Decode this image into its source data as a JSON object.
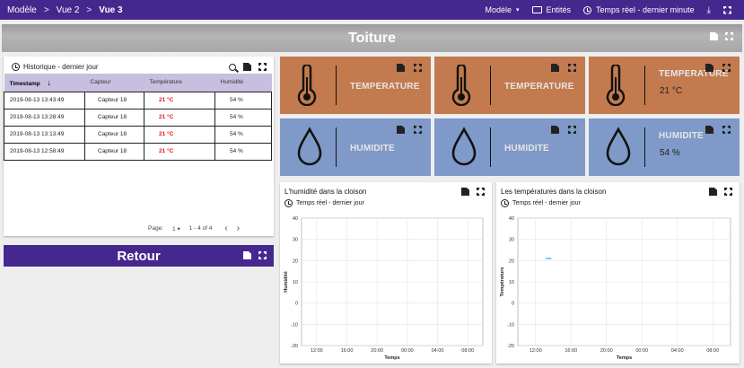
{
  "breadcrumb": {
    "items": [
      "Modèle",
      "Vue 2",
      "Vue 3"
    ],
    "separator": ">"
  },
  "topbar": {
    "model_select": "Modèle",
    "entities": "Entités",
    "realtime": "Temps réel - dernier minute"
  },
  "hero": {
    "title": "Toiture"
  },
  "history": {
    "title": "Historique - dernier jour",
    "columns": [
      "Timestamp",
      "Capteur",
      "Température",
      "Humidité"
    ],
    "rows": [
      [
        "2019-08-13 13:43:49",
        "Capteur 18",
        "21 °C",
        "54 %"
      ],
      [
        "2019-08-13 13:28:49",
        "Capteur 18",
        "21 °C",
        "54 %"
      ],
      [
        "2019-08-13 13:13:49",
        "Capteur 18",
        "21 °C",
        "54 %"
      ],
      [
        "2019-08-13 12:58:49",
        "Capteur 18",
        "21 °C",
        "54 %"
      ]
    ],
    "pager": {
      "page_label": "Page:",
      "page": "1",
      "range": "1 - 4 of 4"
    }
  },
  "retour": {
    "label": "Retour"
  },
  "tiles": {
    "temp1": {
      "label": "TEMPERATURE"
    },
    "temp2": {
      "label": "TEMPERATURE"
    },
    "temp3": {
      "label": "TEMPERATURE",
      "value": "21 °C"
    },
    "hum1": {
      "label": "HUMIDITE"
    },
    "hum2": {
      "label": "HUMIDITE"
    },
    "hum3": {
      "label": "HUMIDITE",
      "value": "54 %"
    }
  },
  "colors": {
    "header": "#45288e",
    "temp_tile": "#c27a4e",
    "hum_tile": "#7f9ac8",
    "series": "#4fc3f7",
    "alert": "#e11111"
  },
  "chart_data": [
    {
      "type": "line",
      "title": "L'humidité dans la cloison",
      "subtitle": "Temps réel - dernier jour",
      "xlabel": "Temps",
      "ylabel": "Humidité",
      "ylim": [
        -20,
        40
      ],
      "yticks": [
        -20,
        -10,
        0,
        10,
        20,
        30,
        40
      ],
      "xticks": [
        "12:00",
        "16:00",
        "20:00",
        "00:00",
        "04:00",
        "08:00"
      ],
      "grid": true,
      "series": []
    },
    {
      "type": "line",
      "title": "Les températures dans la cloison",
      "subtitle": "Temps réel - dernier jour",
      "xlabel": "Temps",
      "ylabel": "Température",
      "ylim": [
        -20,
        40
      ],
      "yticks": [
        -20,
        -10,
        0,
        10,
        20,
        30,
        40
      ],
      "xticks": [
        "12:00",
        "16:00",
        "20:00",
        "00:00",
        "04:00",
        "08:00"
      ],
      "grid": true,
      "series": [
        {
          "x": [
            "13:13",
            "13:43"
          ],
          "values": [
            21,
            21
          ]
        }
      ]
    }
  ]
}
